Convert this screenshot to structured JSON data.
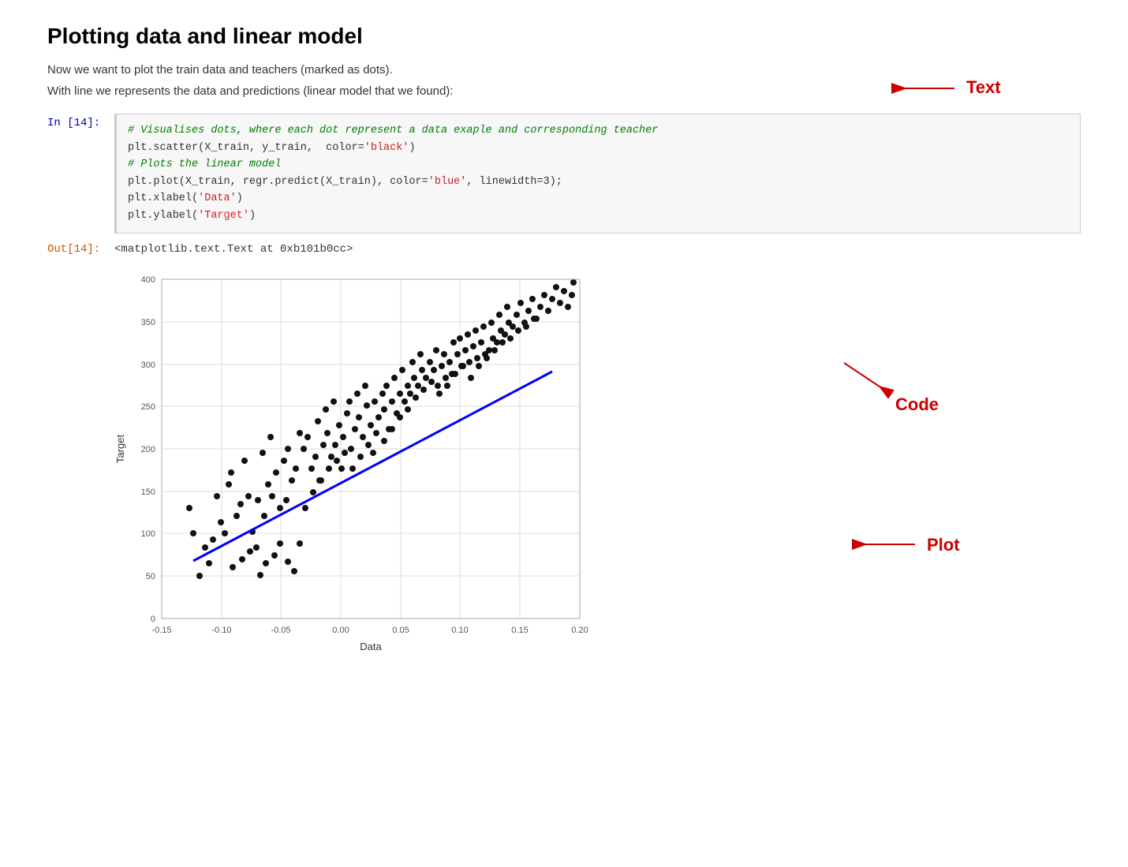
{
  "title": "Plotting data and linear model",
  "paragraphs": [
    "Now we want to plot the train data and teachers (marked as dots).",
    "With line we represents the data and predictions (linear model that we found):"
  ],
  "cell_in_label": "In [14]:",
  "cell_out_label": "Out[14]:",
  "code_lines": [
    {
      "type": "comment",
      "text": "# Visualises dots, where each dot represent a data exaple and corresponding teacher"
    },
    {
      "type": "code",
      "text": "plt.scatter(X_train, y_train,  color=",
      "string": "'black'",
      "after": ")"
    },
    {
      "type": "comment",
      "text": "# Plots the linear model"
    },
    {
      "type": "code",
      "text": "plt.plot(X_train, regr.predict(X_train), color=",
      "string": "'blue'",
      "after": ", linewidth=3);"
    },
    {
      "type": "code_str",
      "text": "plt.xlabel(",
      "string": "'Data'",
      "after": ")"
    },
    {
      "type": "code_str",
      "text": "plt.ylabel(",
      "string": "'Target'",
      "after": ")"
    }
  ],
  "output_text": "<matplotlib.text.Text at 0xb101b0cc>",
  "annotations": {
    "text_label": "Text",
    "code_label": "Code",
    "plot_label": "Plot"
  },
  "chart": {
    "x_label": "Data",
    "y_label": "Target",
    "x_ticks": [
      "-0.15",
      "-0.10",
      "-0.05",
      "0.00",
      "0.05",
      "0.10",
      "0.15",
      "0.20"
    ],
    "y_ticks": [
      "0",
      "50",
      "100",
      "150",
      "200",
      "250",
      "300",
      "350",
      "400"
    ]
  }
}
